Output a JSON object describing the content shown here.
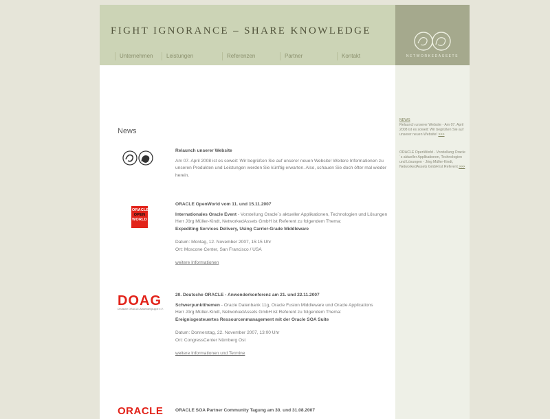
{
  "header": {
    "tagline": "FIGHT IGNORANCE – SHARE KNOWLEDGE",
    "logo_text": "NETWORKEDASSETS",
    "nav": [
      "Unternehmen",
      "Leistungen",
      "Referenzen",
      "Partner",
      "Kontakt"
    ]
  },
  "main": {
    "heading": "News",
    "items": [
      {
        "logo": "networkedassets-logo",
        "title": "Relaunch unserer Website",
        "paragraph": "Am 07. April 2008 ist es soweit: Wir begrüßen Sie auf unserer neuen Website! Weitere Informationen zu unseren Produkten und Leistungen werden Sie künftig erwarten. Also, schauen Sie doch öfter mal wieder herein."
      },
      {
        "logo": "oracle-openworld-logo",
        "logo_text": [
          "ORACLE",
          "OPEN",
          "WORLD"
        ],
        "title": "ORACLE OpenWorld vom 11. und 15.11.2007",
        "lead_bold": "Internationales Oracle Event",
        "lead_rest": " - Vorstellung Oracle´s aktueller Applikationen, Technologien und Lösungen",
        "line2": "Herr Jörg Müller-Kindt, NetworkedAssets GmbH ist Referent zu folgendem Thema:",
        "topic": "Expediting Services Delivery, Using Carrier-Grade Middleware",
        "date": "Datum: Montag, 12. November 2007, 15:15 Uhr",
        "place": "Ort: Moscone Center, San Francisco / USA",
        "link": "weitere Informationen"
      },
      {
        "logo": "doag-logo",
        "logo_text": "DOAG",
        "logo_sub": "Deutsche ORACLE-Anwendergruppe e.V.",
        "title": "20. Deutsche ORACLE - Anwenderkonferenz am 21. und 22.11.2007",
        "lead_bold": "Schwerpunktthemen",
        "lead_rest": " - Oracle Datenbank 11g, Oracle Fusion Middleware und Oracle Applications",
        "line2": "Herr Jörg Müller-Kindt, NetworkedAssets GmbH ist Referent zu folgendem Thema:",
        "topic": "Ereignisgesteuertes Ressourcenmanagement mit der Oracle SOA Suite",
        "date": "Datum: Donnerstag, 22. November 2007, 13:00 Uhr",
        "place": "Ort: CongressCenter Nürnberg Ost",
        "link": "weitere Informationen und Termine"
      },
      {
        "logo": "oracle-logo",
        "logo_text": "ORACLE",
        "title": "ORACLE SOA Partner Community Tagung am 30. und 31.08.2007"
      }
    ]
  },
  "sidebar": {
    "news_label": "NEWS",
    "news_text": "Relaunch unserer Website - Am 07. April 2008 ist es soweit: Wir begrüßen Sie auf unserer neuen Website!",
    "more": ">>>",
    "event_text": "ORACLE OpenWorld - Vorstellung Oracle´s aktueller Applikationen, Technologien und Lösungen - Jörg Müller-Kindt, NetworkedAssets GmbH ist Referent"
  },
  "colors": {
    "background": "#e6e5d9",
    "header": "#ccd4b6",
    "logo_box": "#a5a98d",
    "sidebar": "#eef0e7",
    "oracle_red": "#e2231a"
  }
}
